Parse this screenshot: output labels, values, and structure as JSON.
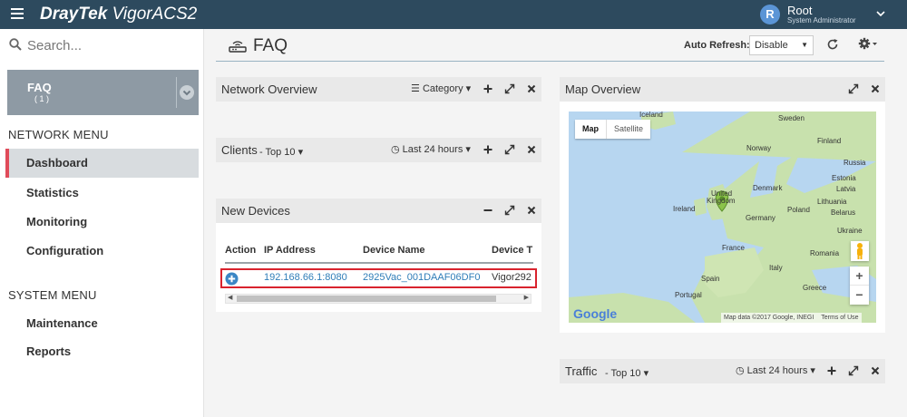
{
  "app": {
    "brand_part1": "DrayTek",
    "brand_part2": "VigorACS2"
  },
  "user": {
    "initial": "R",
    "name": "Root",
    "role": "System Administrator"
  },
  "sidebar": {
    "search_placeholder": "Search...",
    "site": {
      "name": "FAQ",
      "count": "( 1 )"
    },
    "network_menu_title": "NETWORK MENU",
    "network_items": [
      {
        "label": "Dashboard"
      },
      {
        "label": "Statistics"
      },
      {
        "label": "Monitoring"
      },
      {
        "label": "Configuration"
      }
    ],
    "system_menu_title": "SYSTEM MENU",
    "system_items": [
      {
        "label": "Maintenance"
      },
      {
        "label": "Reports"
      }
    ]
  },
  "header": {
    "title": "FAQ",
    "auto_refresh_label": "Auto Refresh:",
    "auto_refresh_value": "Disable"
  },
  "panels": {
    "network_overview": {
      "title": "Network Overview",
      "category_label": "Category"
    },
    "clients": {
      "title": "Clients",
      "subtitle": "- Top 10",
      "range_label": "Last 24 hours"
    },
    "new_devices": {
      "title": "New Devices",
      "columns": [
        "Action",
        "IP Address",
        "Device Name",
        "Device T"
      ],
      "rows": [
        {
          "ip": "192.168.66.1:8080",
          "device_name": "2925Vac_001DAAF06DF0",
          "device_type": "Vigor292"
        }
      ]
    },
    "map_overview": {
      "title": "Map Overview",
      "map_button": "Map",
      "satellite_button": "Satellite",
      "google": "Google",
      "attribution": "Map data ©2017 Google, INEGI",
      "terms": "Terms of Use",
      "labels": {
        "iceland": "Iceland",
        "sweden": "Sweden",
        "finland": "Finland",
        "norway": "Norway",
        "russia": "Russia",
        "estonia": "Estonia",
        "latvia": "Latvia",
        "lithuania": "Lithuania",
        "belarus": "Belarus",
        "denmark": "Denmark",
        "united": "United",
        "kingdom": "Kingdom",
        "ireland": "Ireland",
        "germany": "Germany",
        "poland": "Poland",
        "ukraine": "Ukraine",
        "france": "France",
        "italy": "Italy",
        "romania": "Romania",
        "spain": "Spain",
        "portugal": "Portugal",
        "greece": "Greece"
      },
      "zoom_in": "+",
      "zoom_out": "−"
    },
    "traffic": {
      "title": "Traffic",
      "subtitle": "- Top 10",
      "range_label": "Last 24 hours"
    }
  },
  "colors": {
    "topbar": "#2d4a5e",
    "active_nav_accent": "#e04b5a",
    "link": "#2f7db8",
    "highlight_border": "#d9232e",
    "map_water": "#b7d6f0",
    "map_land": "#c8e1ad"
  }
}
